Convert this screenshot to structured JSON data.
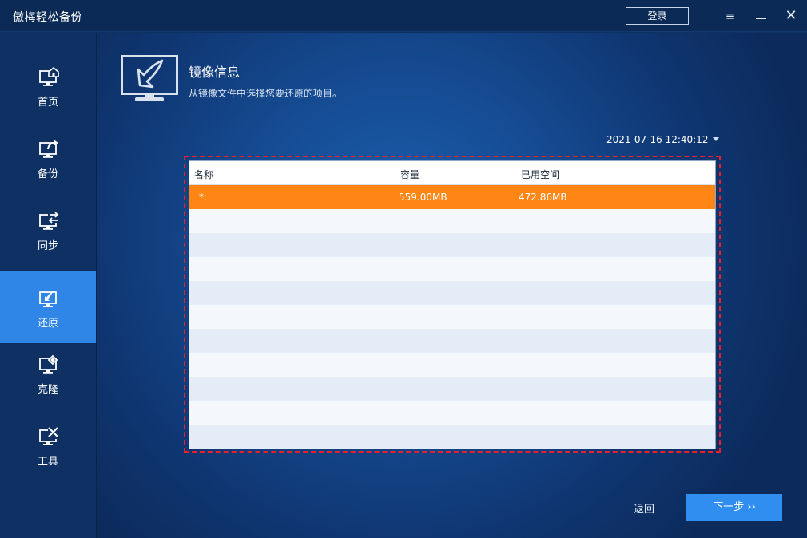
{
  "app": {
    "title": "傲梅轻松备份",
    "login_label": "登录",
    "menu_icon": "≡",
    "close_icon": "✕"
  },
  "sidebar": {
    "items": [
      {
        "label": "首页",
        "icon": "home-icon",
        "active": false
      },
      {
        "label": "备份",
        "icon": "backup-icon",
        "active": false
      },
      {
        "label": "同步",
        "icon": "sync-icon",
        "active": false
      },
      {
        "label": "还原",
        "icon": "restore-icon",
        "active": true
      },
      {
        "label": "克隆",
        "icon": "clone-icon",
        "active": false
      },
      {
        "label": "工具",
        "icon": "tools-icon",
        "active": false
      }
    ]
  },
  "page": {
    "title": "镜像信息",
    "subtitle": "从镜像文件中选择您要还原的项目。"
  },
  "backup_point": {
    "selected": "2021-07-16 12:40:12"
  },
  "table": {
    "columns": [
      "名称",
      "容量",
      "已用空间"
    ],
    "rows": [
      {
        "name": "*:",
        "capacity": "559.00MB",
        "used": "472.86MB",
        "selected": true
      }
    ]
  },
  "footer": {
    "back_label": "返回",
    "next_label": "下一步 ››"
  },
  "colors": {
    "accent": "#2f86e6",
    "selected_row": "#ff8615",
    "highlight_frame": "#e8202a"
  }
}
